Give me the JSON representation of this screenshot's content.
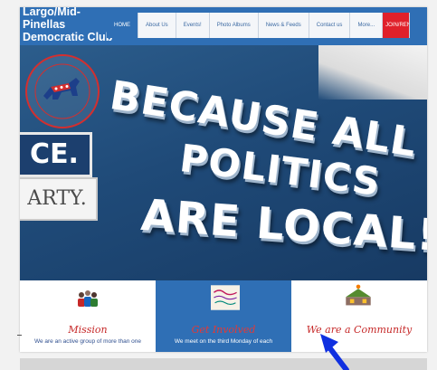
{
  "site": {
    "title_line1": "Largo/Mid-Pinellas",
    "title_line2": "Democratic Club"
  },
  "nav": {
    "items": [
      {
        "label": "HOME",
        "active": true
      },
      {
        "label": "About Us"
      },
      {
        "label": "Events!"
      },
      {
        "label": "Photo Albums"
      },
      {
        "label": "News & Feeds"
      },
      {
        "label": "Contact us"
      },
      {
        "label": "More..."
      }
    ],
    "join_label": "JOIN/RENEW"
  },
  "hero": {
    "line1": "BECAUSE ALL",
    "line2": "POLITICS",
    "line3": "ARE LOCAL!",
    "sign_left_top": "CE.",
    "sign_left_bottom": "ARTY."
  },
  "cards": [
    {
      "title": "Mission",
      "text": "We are an active group of more than one",
      "icon": "people-icon"
    },
    {
      "title": "Get Involved",
      "text": "We meet on the third Monday of each",
      "icon": "involved-graphic-icon"
    },
    {
      "title": "We are a Community",
      "text": "",
      "icon": "community-icon"
    }
  ],
  "colors": {
    "nav_blue": "#2f6fb5",
    "join_red": "#e0202a",
    "title_red": "#c62828",
    "arrow_blue": "#1030e0"
  }
}
